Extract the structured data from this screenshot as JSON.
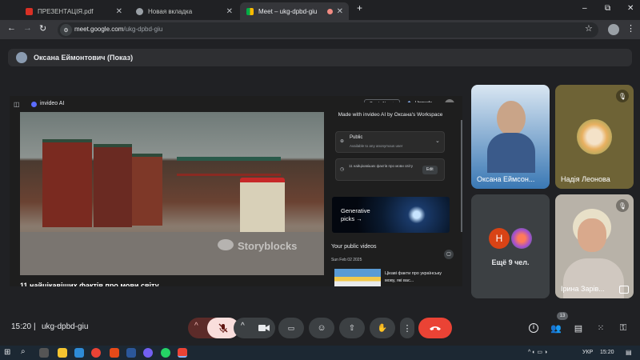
{
  "tabs": [
    {
      "label": "ПРЕЗЕНТАЦІЯ.pdf",
      "color": "#d93025"
    },
    {
      "label": "Новая вкладка",
      "color": "#9aa0a6"
    },
    {
      "label": "Meet – ukg-dpbd-giu",
      "color": "#00ac47"
    }
  ],
  "window": {
    "new_tab": "+",
    "minimize": "–",
    "maximize": "⧉",
    "close": "✕"
  },
  "address": {
    "host": "meet.google.com",
    "path": "/ukg-dpbd-giu"
  },
  "presenter": {
    "label": "Оксана Еймонтович (Показ)"
  },
  "shared": {
    "app_name": "invideo AI",
    "create_new": "Create New +",
    "upgrade": "Upgrade",
    "made_with": "Made with invideo AI by Оксана's Workspace",
    "public_title": "Public",
    "public_sub": "Available to any anonymous user",
    "fact_line": "11 найцікавіших фактів про мови світу",
    "edit": "Edit",
    "generative": "Generative picks →",
    "your_public": "Your public videos",
    "date": "Sun Feb 02 2025",
    "video_title": "Цікаві факти про українську мову, які вас...",
    "storyblocks": "Storyblocks",
    "caption": "11 найцікавіших фактів про мови світу"
  },
  "participants": {
    "oksana": "Оксана Еймсон...",
    "nadia": "Надія Леонова",
    "more": "Ещё 9 чел.",
    "more_initial": "Н",
    "iryna": "Ірина Зарів..."
  },
  "bottom": {
    "time": "15:20",
    "meeting_code": "ukg-dpbd-giu",
    "people_count": "13"
  },
  "taskbar": {
    "lang": "УКР",
    "time": "15:20"
  },
  "colors": {
    "accent_red": "#ea4335",
    "mic_off_bg": "#f9dedc",
    "avatar_n": "#d84315"
  }
}
